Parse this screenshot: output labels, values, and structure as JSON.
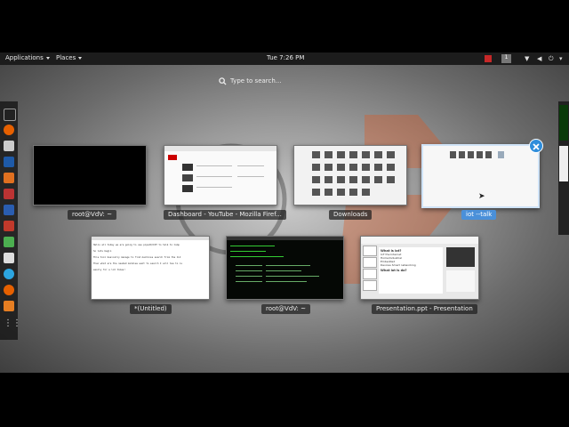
{
  "topbar": {
    "applications": "Applications",
    "places": "Places",
    "clock": "Tue  7:26 PM",
    "workspace": "1"
  },
  "search": {
    "placeholder": "Type to search..."
  },
  "windows": [
    {
      "caption": "root@VdV: ~",
      "active": false
    },
    {
      "caption": "Dashboard - YouTube - Mozilla Firef...",
      "active": false
    },
    {
      "caption": "Downloads",
      "active": false
    },
    {
      "caption": "iot --talk",
      "active": true
    },
    {
      "caption": "*(Untitled)",
      "active": false
    },
    {
      "caption": "root@VdV: ~",
      "active": false
    },
    {
      "caption": "Presentation.ppt - Presentation",
      "active": false
    }
  ],
  "text_editor_lines": [
    "Hello all today we are going to use pipeIO/IOT to talk to Comp",
    "So lets begin",
    "This tool basically manage to find machines search from the CLI",
    "Then what are the needed modules want to search I will how to is",
    "easily for a lot times!"
  ],
  "presentation_slide": {
    "heading": "What is iot?",
    "bullets": [
      "IoT the Internet",
      "Home/Industrial",
      "Embedded",
      "Devices Smart networking"
    ],
    "heading2": "What iot is do?"
  },
  "dock_icons": [
    "terminal-icon",
    "firefox-icon",
    "files-icon",
    "metasploit-icon",
    "burp-icon",
    "armitage-icon",
    "maltego-icon",
    "zap-icon",
    "leafpad-icon",
    "keyboard-icon",
    "telegram-icon",
    "firefox-alt-icon",
    "office-icon",
    "show-apps-icon"
  ],
  "colors": {
    "accent": "#4a90d9",
    "topbar": "#1c1c1c"
  }
}
